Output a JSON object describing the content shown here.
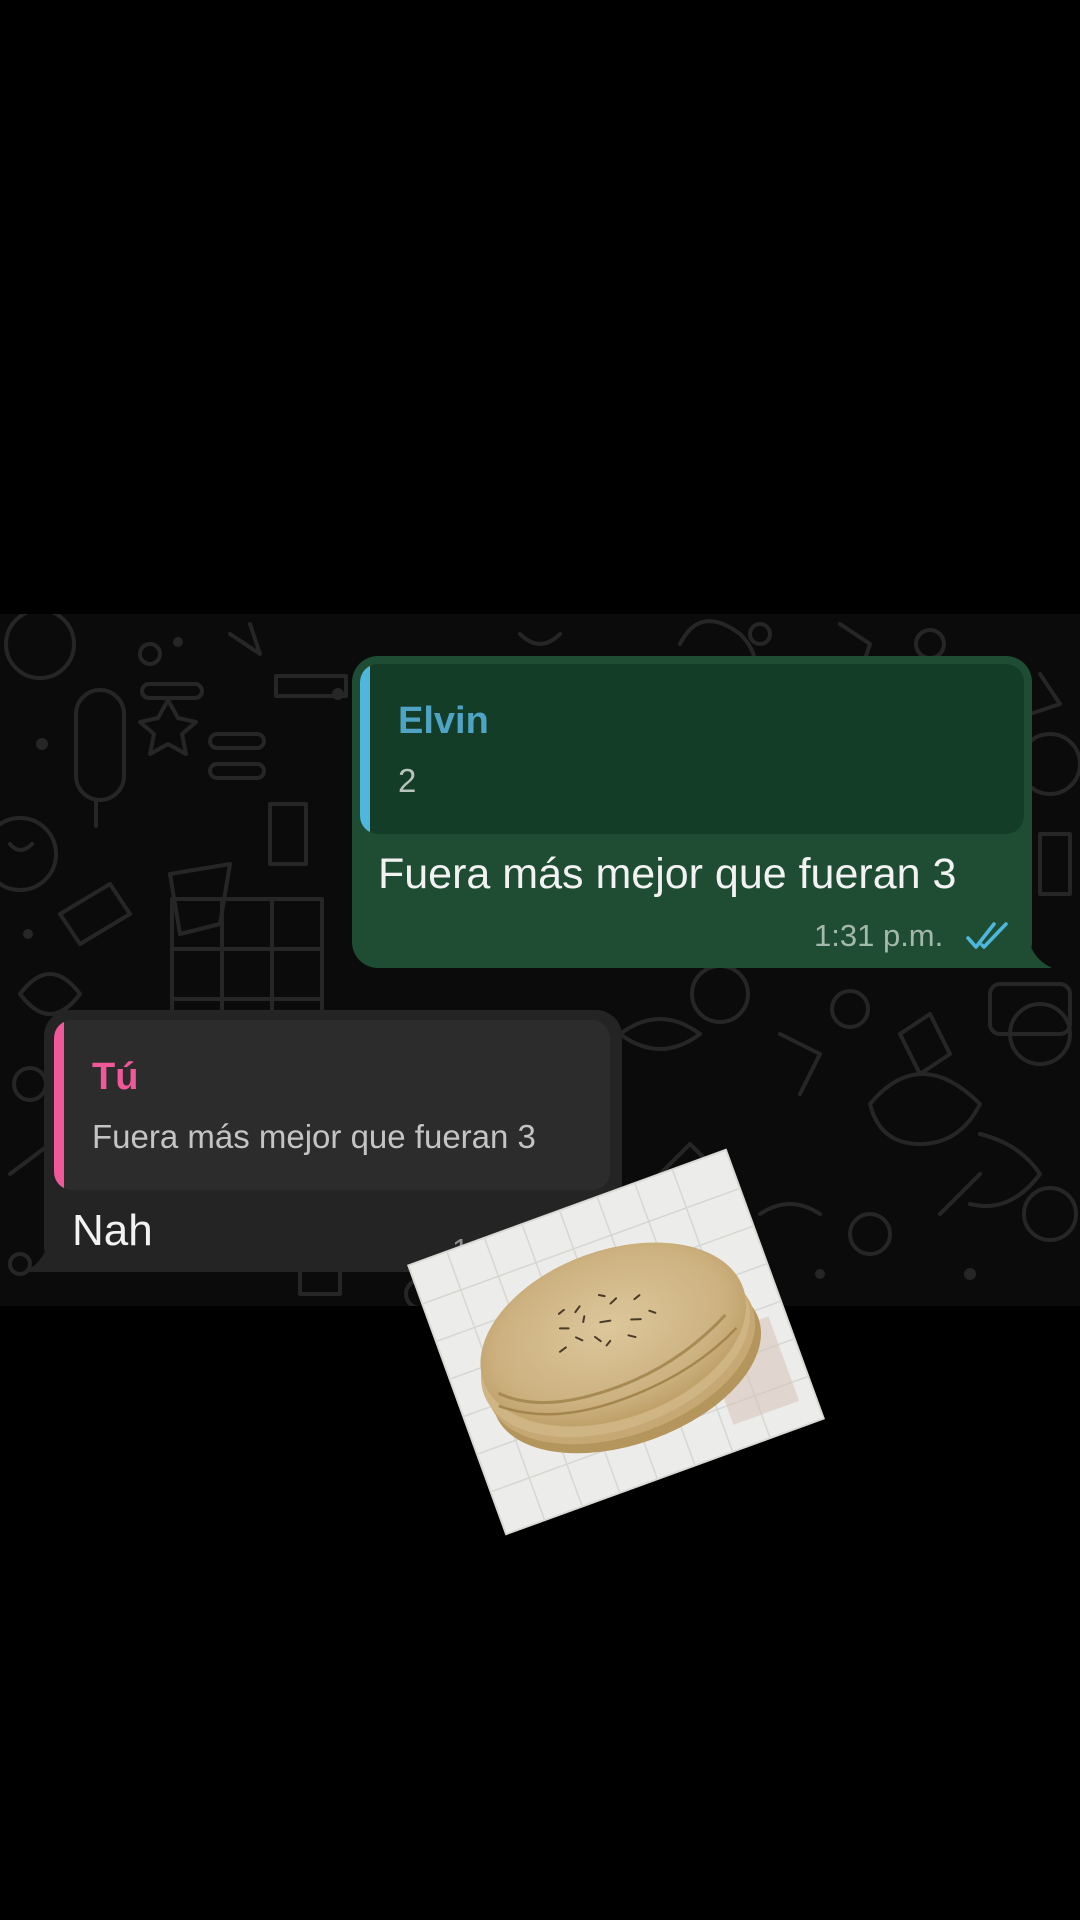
{
  "outgoing_message": {
    "reply_author": "Elvin",
    "reply_text": "2",
    "text": "Fuera más mejor que fueran 3",
    "time": "1:31 p.m.",
    "status_icon": "double-check-read-icon",
    "bubble_color": "#1f4d33",
    "quote_bar_color": "#4fb6dc"
  },
  "incoming_message": {
    "reply_author": "Tú",
    "reply_text": "Fuera más mejor que fueran 3",
    "text": "Nah",
    "time": "1:31 p.m.",
    "bubble_color": "#242424",
    "quote_bar_color": "#f0589a"
  },
  "sticker": {
    "icon": "tortillas-sticker"
  },
  "colors": {
    "background": "#000000",
    "chat_background": "#0b0b0b",
    "read_ticks": "#4fb6dc"
  }
}
